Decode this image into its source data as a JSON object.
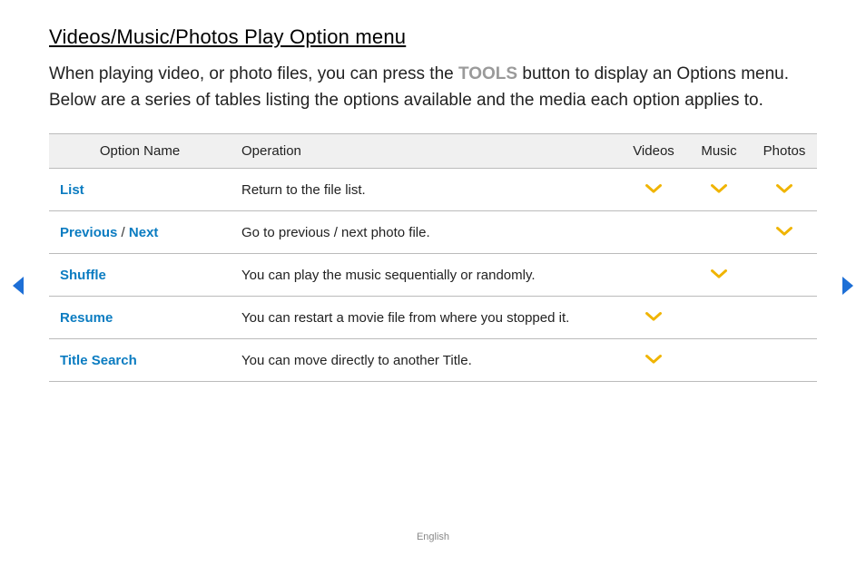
{
  "title": "Videos/Music/Photos Play Option menu",
  "intro": {
    "pre": "When playing video, or photo files, you can press the ",
    "tools": "TOOLS",
    "post": " button to display an Options menu. Below are a series of tables listing the options available and the media each option applies to."
  },
  "headers": {
    "name": "Option Name",
    "operation": "Operation",
    "videos": "Videos",
    "music": "Music",
    "photos": "Photos"
  },
  "rows": [
    {
      "name_parts": [
        "List"
      ],
      "operation": "Return to the file list.",
      "videos": true,
      "music": true,
      "photos": true
    },
    {
      "name_parts": [
        "Previous",
        " / ",
        "Next"
      ],
      "operation": "Go to previous / next photo file.",
      "videos": false,
      "music": false,
      "photos": true
    },
    {
      "name_parts": [
        "Shuffle"
      ],
      "operation": "You can play the music sequentially or randomly.",
      "videos": false,
      "music": true,
      "photos": false
    },
    {
      "name_parts": [
        "Resume"
      ],
      "operation": "You can restart a movie file from where you stopped it.",
      "videos": true,
      "music": false,
      "photos": false
    },
    {
      "name_parts": [
        "Title Search"
      ],
      "operation": "You can move directly to another Title.",
      "videos": true,
      "music": false,
      "photos": false
    }
  ],
  "icons": {
    "check_color": "#f0b400",
    "nav_color": "#1d6fd6"
  },
  "footer": "English"
}
